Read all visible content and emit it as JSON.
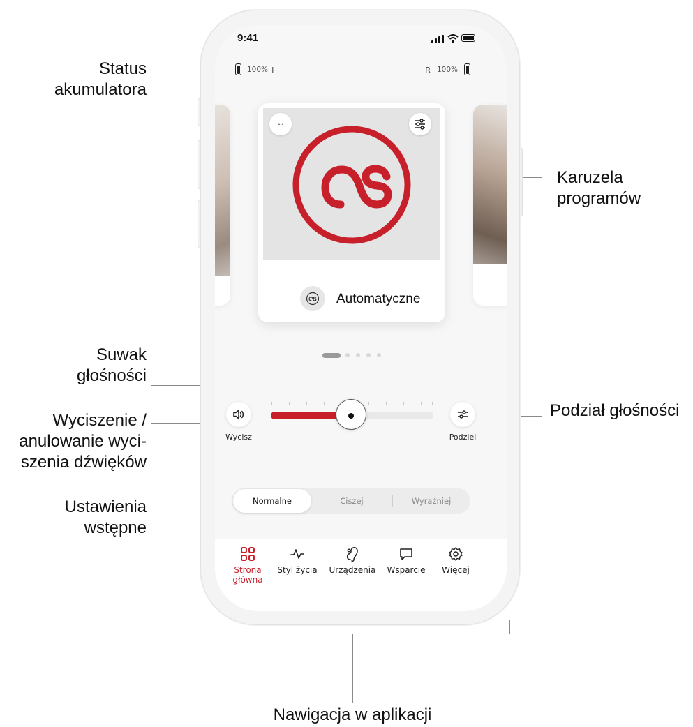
{
  "annotations": {
    "battery_status": [
      "Status",
      "akumulatora"
    ],
    "program_carousel": [
      "Karuzela",
      "programów"
    ],
    "volume_slider": [
      "Suwak",
      "głośności"
    ],
    "mute": [
      "Wyciszenie /",
      "anulowanie wyci-",
      "szenia dźwięków"
    ],
    "presets": [
      "Ustawienia",
      "wstępne"
    ],
    "volume_split": "Podział głośności",
    "app_navigation": "Nawigacja w aplikacji"
  },
  "status_bar": {
    "time": "9:41"
  },
  "battery": {
    "left_percent": "100%",
    "left_side": "L",
    "right_side": "R",
    "right_percent": "100%"
  },
  "program": {
    "name": "Automatyczne",
    "more_label": "···",
    "logo_icon": "program-logo-icon"
  },
  "carousel": {
    "page_count": 5,
    "active_index": 0
  },
  "volume": {
    "mute_label": "Wycisz",
    "split_label": "Podziel",
    "level": 0.5
  },
  "presets": {
    "options": [
      "Normalne",
      "Ciszej",
      "Wyraźniej"
    ],
    "selected_index": 0
  },
  "nav": {
    "items": [
      {
        "label_line1": "Strona",
        "label_line2": "główna",
        "icon": "grid-icon",
        "active": true
      },
      {
        "label_line1": "Styl życia",
        "label_line2": "",
        "icon": "activity-icon",
        "active": false
      },
      {
        "label_line1": "Urządzenia",
        "label_line2": "",
        "icon": "hearing-aid-icon",
        "active": false
      },
      {
        "label_line1": "Wsparcie",
        "label_line2": "",
        "icon": "chat-bubble-icon",
        "active": false
      },
      {
        "label_line1": "Więcej",
        "label_line2": "",
        "icon": "gear-icon",
        "active": false
      }
    ]
  },
  "colors": {
    "accent": "#c8202a",
    "track": "#e9e9e9",
    "background": "#f7f7f7"
  }
}
